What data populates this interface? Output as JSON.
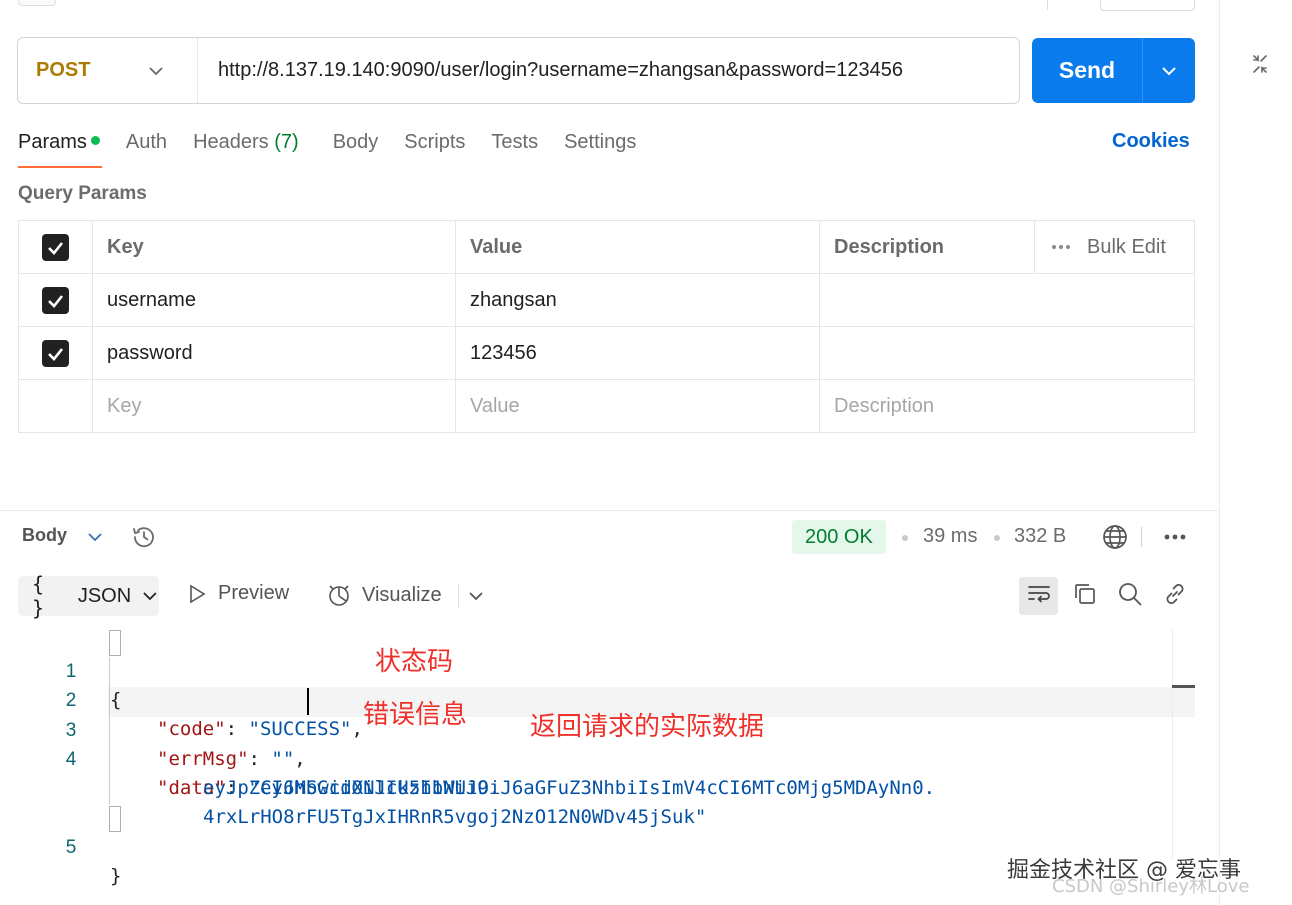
{
  "request": {
    "method": "POST",
    "url": "http://8.137.19.140:9090/user/login?username=zhangsan&password=123456",
    "send_label": "Send"
  },
  "tabs": {
    "params": "Params",
    "auth": "Auth",
    "headers": "Headers",
    "headers_count": "(7)",
    "body": "Body",
    "scripts": "Scripts",
    "tests": "Tests",
    "settings": "Settings",
    "cookies": "Cookies"
  },
  "query_params": {
    "title": "Query Params",
    "headers": {
      "key": "Key",
      "value": "Value",
      "description": "Description",
      "bulk_edit": "Bulk Edit"
    },
    "rows": [
      {
        "key": "username",
        "value": "zhangsan",
        "description": "",
        "checked": true
      },
      {
        "key": "password",
        "value": "123456",
        "description": "",
        "checked": true
      }
    ],
    "placeholder": {
      "key": "Key",
      "value": "Value",
      "description": "Description"
    }
  },
  "response": {
    "section_label": "Body",
    "status": "200 OK",
    "time": "39 ms",
    "size": "332 B",
    "format": "JSON",
    "preview_label": "Preview",
    "visualize_label": "Visualize",
    "lines": {
      "l1": {
        "num": "1",
        "text": "{"
      },
      "l2": {
        "num": "2",
        "key": "\"code\"",
        "colon": ": ",
        "value": "\"SUCCESS\"",
        "comma": ","
      },
      "l3": {
        "num": "3",
        "key": "\"errMsg\"",
        "colon": ": ",
        "value": "\"\"",
        "comma": ","
      },
      "l4": {
        "num": "4",
        "key": "\"data\"",
        "colon": ": ",
        "value_1": "\"eyJhbGciOiJIUzI1NiJ9.",
        "value_2": "eyJpZCI6MSwidXNlck5hbWUiOiJ6aGFuZ3NhbiIsImV4cCI6MTc0Mjg5MDAyNn0.",
        "value_3": "4rxLrHO8rFU5TgJxIHRnR5vgoj2NzO12N0WDv45jSuk\""
      },
      "l5": {
        "num": "5",
        "text": "}"
      }
    }
  },
  "annotations": {
    "status_code": "状态码",
    "error_info": "错误信息",
    "returned_data": "返回请求的实际数据"
  },
  "watermark": {
    "juejin": "掘金技术社区 @ 爱忘事",
    "csdn": "CSDN @Shirley林Love"
  },
  "colors": {
    "accent": "#ff6c37",
    "send": "#097bed",
    "method": "#ad7a03",
    "link": "#0265d2",
    "status_bg": "#e5f7eb",
    "status_fg": "#007f31",
    "annotation": "#f0302a"
  }
}
